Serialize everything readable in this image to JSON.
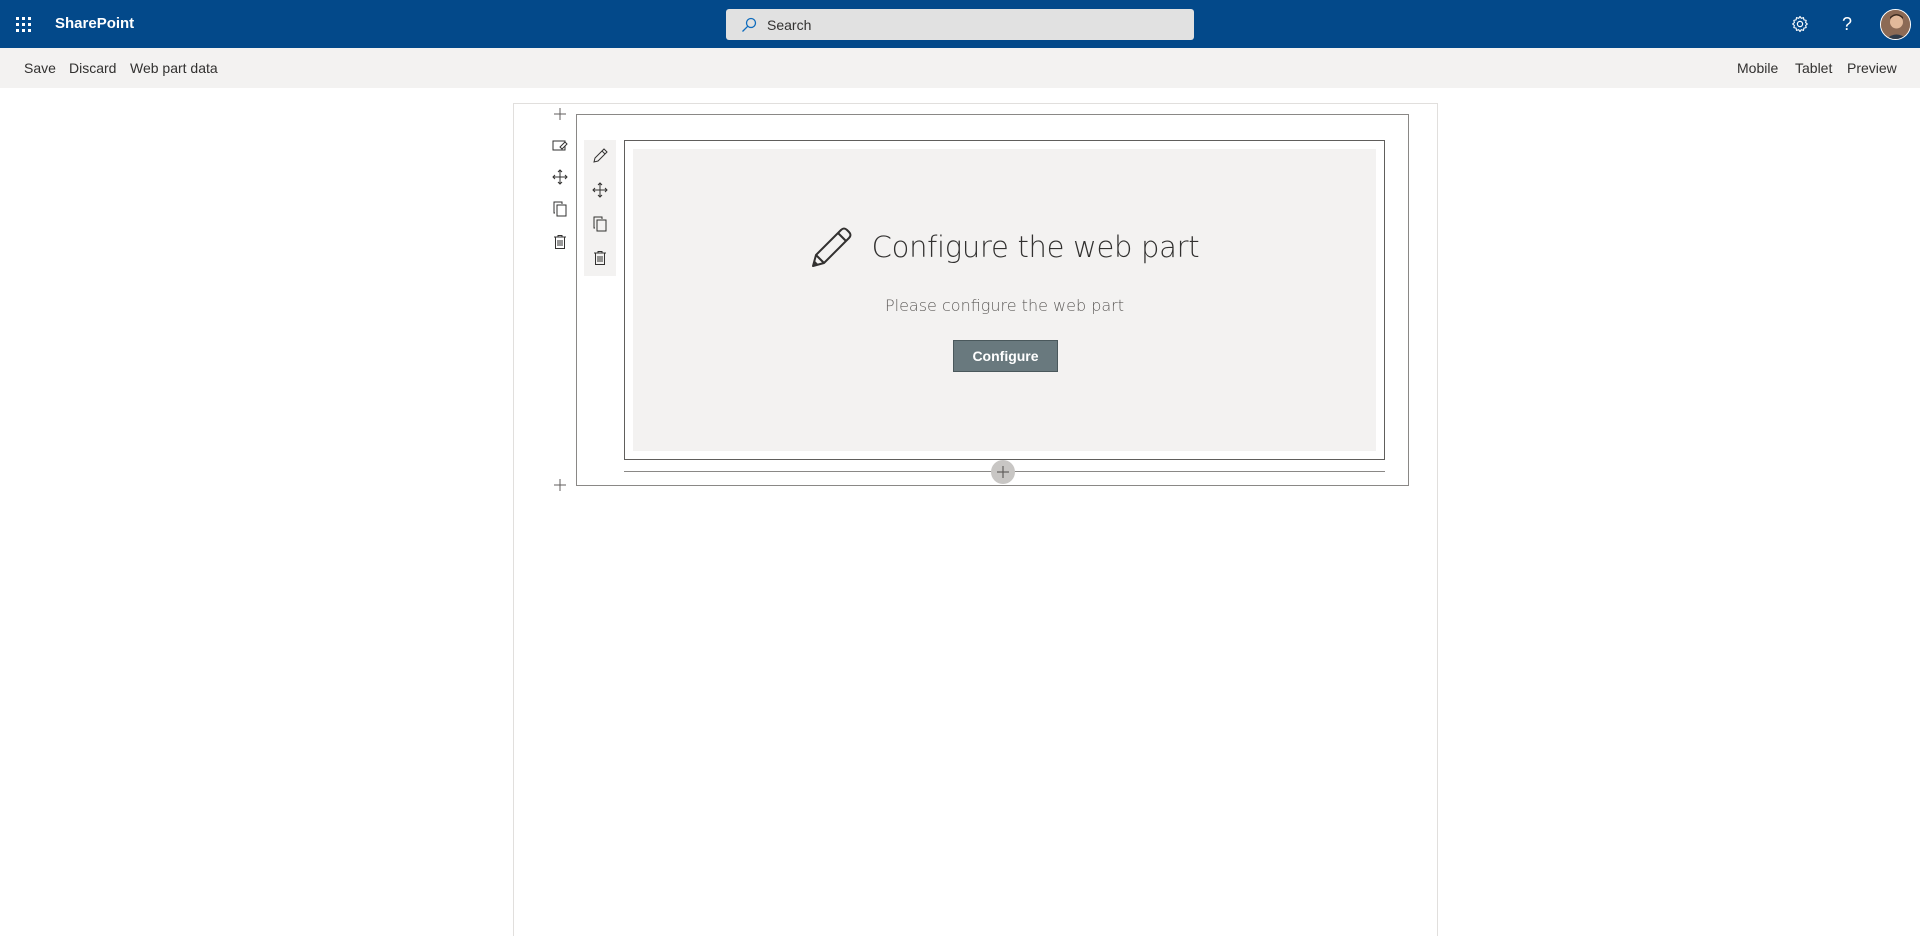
{
  "suitebar": {
    "app_name": "SharePoint",
    "search_placeholder": "Search",
    "help_label": "?"
  },
  "commandbar": {
    "left": [
      {
        "label": "Save"
      },
      {
        "label": "Discard"
      },
      {
        "label": "Web part data"
      }
    ],
    "right": [
      {
        "label": "Mobile"
      },
      {
        "label": "Tablet"
      },
      {
        "label": "Preview"
      }
    ]
  },
  "webpart": {
    "title": "Configure the web part",
    "description": "Please configure the web part",
    "button_label": "Configure"
  },
  "icons": {
    "waffle": "waffle-icon",
    "search": "search-icon",
    "settings": "gear-icon",
    "help": "help-icon",
    "add_section": "plus-icon",
    "edit_section": "edit-section-icon",
    "move": "move-icon",
    "duplicate": "duplicate-icon",
    "delete": "trash-icon",
    "edit_webpart": "pencil-icon"
  },
  "colors": {
    "suitebar": "#03498a",
    "commandbar": "#f3f2f1",
    "configure_button": "#69797e",
    "placeholder_bg": "#f3f2f1"
  }
}
